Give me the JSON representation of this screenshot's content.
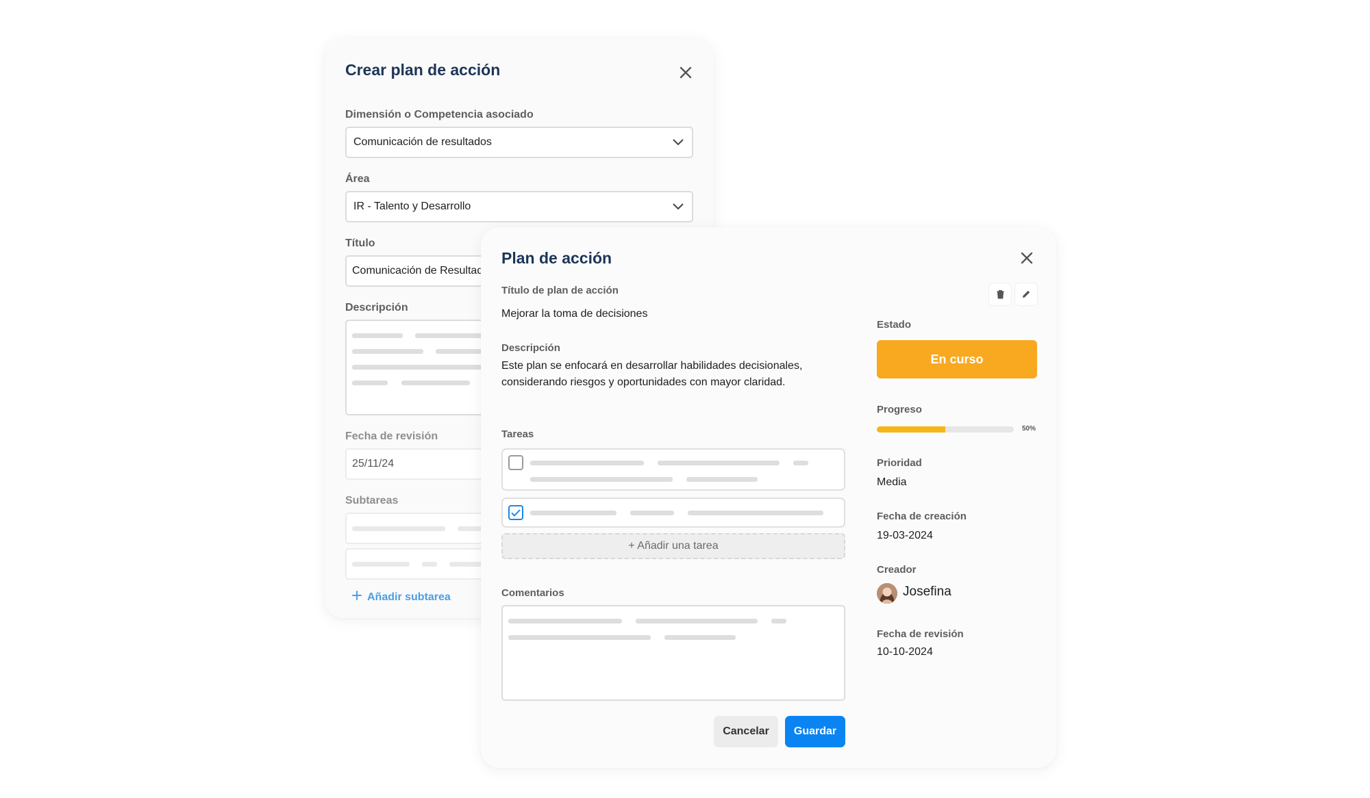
{
  "create_dialog": {
    "title": "Crear plan de acción",
    "dimension_label": "Dimensión o Competencia asociado",
    "dimension_value": "Comunicación de resultados",
    "area_label": "Área",
    "area_value": "IR - Talento y Desarrollo",
    "title_label": "Título",
    "title_value": "Comunicación de Resultados",
    "description_label": "Descripción",
    "review_date_label": "Fecha de revisión",
    "review_date_value": "25/11/24",
    "subtasks_label": "Subtareas",
    "add_subtask": "Añadir subtarea"
  },
  "plan_dialog": {
    "title": "Plan de acción",
    "plan_title_label": "Título de plan de acción",
    "plan_title_value": "Mejorar la toma de decisiones",
    "description_label": "Descripción",
    "description_line1": "Este plan se enfocará en desarrollar habilidades decisionales,",
    "description_line2": "considerando riesgos y oportunidades con mayor claridad.",
    "tasks_label": "Tareas",
    "tasks": [
      {
        "checked": false
      },
      {
        "checked": true
      }
    ],
    "add_task": "+ Añadir una tarea",
    "comments_label": "Comentarios",
    "cancel": "Cancelar",
    "save": "Guardar",
    "sidebar": {
      "status_label": "Estado",
      "status_value": "En curso",
      "status_color": "#f8a920",
      "progress_label": "Progreso",
      "progress_fraction": 0.5,
      "progress_text": "50%",
      "priority_label": "Prioridad",
      "priority_value": "Media",
      "created_label": "Fecha de creación",
      "created_value": "19-03-2024",
      "creator_label": "Creador",
      "creator_name": "Josefina",
      "review_label": "Fecha de revisión",
      "review_value": "10-10-2024"
    }
  },
  "colors": {
    "title": "#1c3557",
    "primary_button": "#0a84f2",
    "link": "#4a9ee6",
    "progress": "#f5b617"
  }
}
